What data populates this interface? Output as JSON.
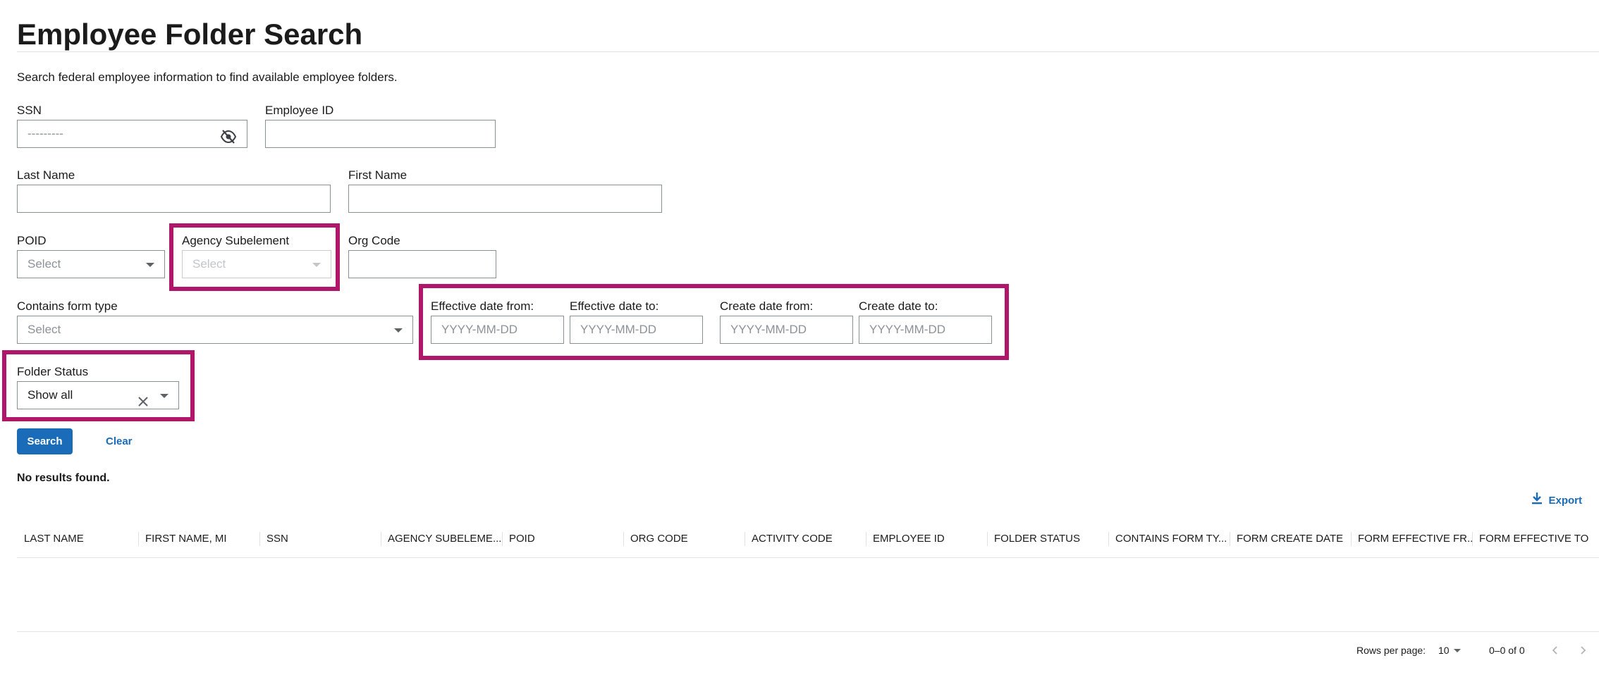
{
  "page": {
    "title": "Employee Folder Search",
    "description": "Search federal employee information to find available employee folders."
  },
  "form": {
    "ssn": {
      "label": "SSN",
      "placeholder": "---------"
    },
    "employee_id": {
      "label": "Employee ID",
      "value": ""
    },
    "last_name": {
      "label": "Last Name",
      "value": ""
    },
    "first_name": {
      "label": "First Name",
      "value": ""
    },
    "poid": {
      "label": "POID",
      "placeholder": "Select"
    },
    "agency_subelement": {
      "label": "Agency Subelement",
      "placeholder": "Select"
    },
    "org_code": {
      "label": "Org Code",
      "value": ""
    },
    "contains_form_type": {
      "label": "Contains form type",
      "placeholder": "Select"
    },
    "effective_date_from": {
      "label": "Effective date from:",
      "placeholder": "YYYY-MM-DD"
    },
    "effective_date_to": {
      "label": "Effective date to:",
      "placeholder": "YYYY-MM-DD"
    },
    "create_date_from": {
      "label": "Create date from:",
      "placeholder": "YYYY-MM-DD"
    },
    "create_date_to": {
      "label": "Create date to:",
      "placeholder": "YYYY-MM-DD"
    },
    "folder_status": {
      "label": "Folder Status",
      "value": "Show all"
    }
  },
  "actions": {
    "search": "Search",
    "clear": "Clear"
  },
  "results": {
    "status": "No results found.",
    "export": "Export",
    "columns": [
      "LAST NAME",
      "FIRST NAME, MI",
      "SSN",
      "AGENCY SUBELEME...",
      "POID",
      "ORG CODE",
      "ACTIVITY CODE",
      "EMPLOYEE ID",
      "FOLDER STATUS",
      "CONTAINS FORM TY...",
      "FORM CREATE DATE",
      "FORM EFFECTIVE FR...",
      "FORM EFFECTIVE TO"
    ]
  },
  "pagination": {
    "rows_label": "Rows per page:",
    "rows_value": "10",
    "range": "0–0 of 0"
  },
  "colors": {
    "accent": "#1a6bb8",
    "highlight": "#b0176b",
    "border": "#8a8f93"
  },
  "icons": [
    "eye-slash-icon",
    "caret-down-icon",
    "clear-x-icon",
    "download-icon",
    "chevron-left-icon",
    "chevron-right-icon"
  ]
}
